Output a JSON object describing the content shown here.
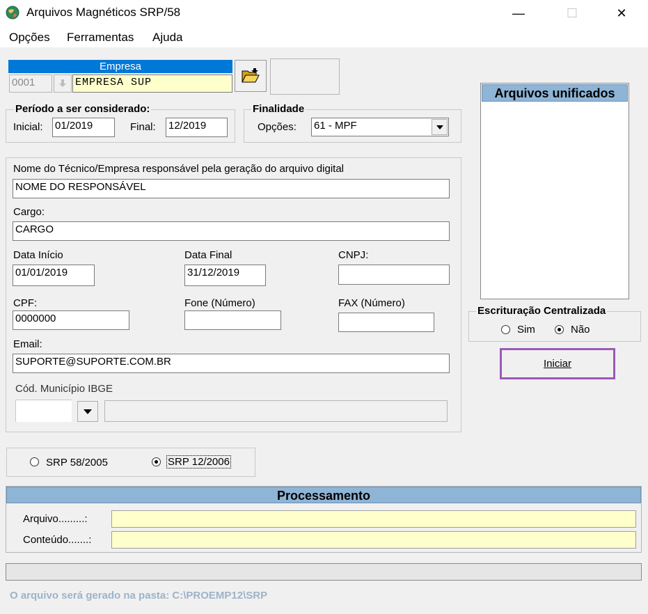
{
  "window": {
    "title": "Arquivos Magnéticos SRP/58",
    "minimize": "—",
    "maximize": "☐",
    "close": "✕"
  },
  "menu": [
    "Opções",
    "Ferramentas",
    "Ajuda"
  ],
  "empresa": {
    "header": "Empresa",
    "code": "0001",
    "name": "EMPRESA SUP"
  },
  "periodo": {
    "legend": "Período a ser considerado:",
    "inicial_label": "Inicial:",
    "inicial_value": "01/2019",
    "final_label": "Final:",
    "final_value": "12/2019"
  },
  "finalidade": {
    "legend": "Finalidade",
    "opcoes_label": "Opções:",
    "opcoes_value": "61 - MPF"
  },
  "responsavel": {
    "nome_label": "Nome do Técnico/Empresa responsável pela geração do arquivo digital",
    "nome_value": "NOME DO RESPONSÁVEL",
    "cargo_label": "Cargo:",
    "cargo_value": "CARGO",
    "data_inicio_label": "Data Início",
    "data_inicio_value": "01/01/2019",
    "data_final_label": "Data Final",
    "data_final_value": "31/12/2019",
    "cnpj_label": "CNPJ:",
    "cnpj_value": "",
    "cpf_label": "CPF:",
    "cpf_value": "0000000",
    "fone_label": "Fone (Número)",
    "fone_value": "",
    "fax_label": "FAX (Número)",
    "fax_value": "",
    "email_label": "Email:",
    "email_value": "SUPORTE@SUPORTE.COM.BR",
    "municipio_label": "Cód. Município IBGE",
    "municipio_code": "",
    "municipio_name": ""
  },
  "srp": {
    "option1": "SRP 58/2005",
    "option2": "SRP 12/2006",
    "selected": "SRP 12/2006"
  },
  "arquivos_unificados": {
    "header": "Arquivos unificados",
    "items": []
  },
  "escrituracao": {
    "legend": "Escrituração Centralizada",
    "sim": "Sim",
    "nao": "Não",
    "selected": "Não"
  },
  "iniciar_label": "Iniciar",
  "processamento": {
    "header": "Processamento",
    "arquivo_label": "Arquivo.........:",
    "arquivo_value": "",
    "conteudo_label": "Conteúdo.......:",
    "conteudo_value": ""
  },
  "status": {
    "progress": 0,
    "message": "O arquivo será gerado na pasta: C:\\PROEMP12\\SRP"
  },
  "colors": {
    "header_blue": "#8eb4d6",
    "empresa_blue": "#0078d7",
    "yellow_field": "#ffffcc",
    "focus_purple": "#9b59b6",
    "status_text": "#9db3c9"
  }
}
